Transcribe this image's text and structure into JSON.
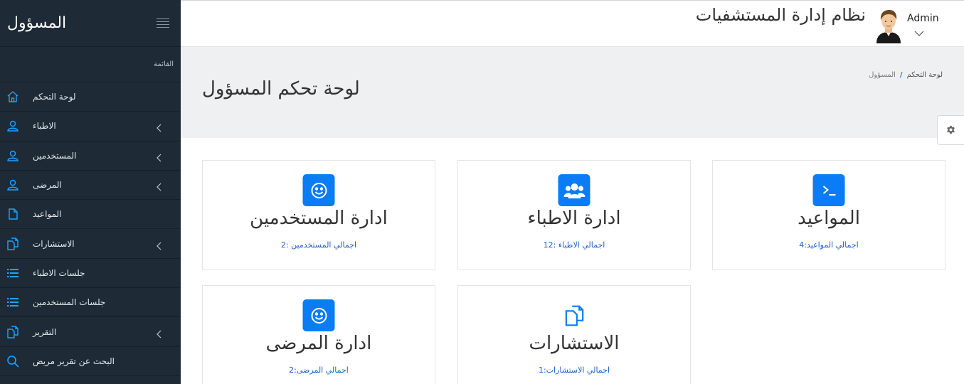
{
  "sidebar": {
    "brand": "المسؤول",
    "menu_heading": "القائمة",
    "items": [
      {
        "label": "لوحة التحكم",
        "icon": "home-icon",
        "has_children": false
      },
      {
        "label": "الاطباء",
        "icon": "user-icon",
        "has_children": true
      },
      {
        "label": "المستخدمين",
        "icon": "user-icon",
        "has_children": true
      },
      {
        "label": "المرضى",
        "icon": "user-icon",
        "has_children": true
      },
      {
        "label": "المواعيد",
        "icon": "file-icon",
        "has_children": false
      },
      {
        "label": "الاستشارات",
        "icon": "files-icon",
        "has_children": true
      },
      {
        "label": "جلسات الاطباء",
        "icon": "list-icon",
        "has_children": false
      },
      {
        "label": "جلسات المستخدمين",
        "icon": "list-icon",
        "has_children": false
      },
      {
        "label": "التقرير",
        "icon": "files-icon",
        "has_children": true
      },
      {
        "label": "البحث عن تقرير مريض",
        "icon": "search-icon",
        "has_children": false
      }
    ]
  },
  "topbar": {
    "system_title": "نظام إدارة المستشفيات",
    "user_name": "Admin"
  },
  "page": {
    "breadcrumb_home": "لوحة التحكم",
    "breadcrumb_separator": "/",
    "breadcrumb_current": "المسؤول",
    "title": "لوحة تحكم المسؤول"
  },
  "cards": {
    "appointments": {
      "title": "المواعيد",
      "stat": "اجمالي المواعيد:4",
      "icon": "terminal-icon"
    },
    "doctors": {
      "title": "ادارة الاطباء",
      "stat": "اجمالي الاطباء :12",
      "icon": "users-group-icon"
    },
    "users": {
      "title": "ادارة المستخدمين",
      "stat": "اجمالي المستخدمين :2",
      "icon": "smile-icon"
    },
    "consultations": {
      "title": "الاستشارات",
      "stat": "اجمالي الاستشارات:1",
      "icon": "files-icon"
    },
    "patients": {
      "title": "ادارة المرضى",
      "stat": "اجمالي المرضى:2",
      "icon": "smile-icon"
    }
  },
  "colors": {
    "sidebar_bg": "#1e2a35",
    "accent": "#0a7cf5",
    "link": "#1a5fcc",
    "header_bg": "#eef0f2"
  }
}
